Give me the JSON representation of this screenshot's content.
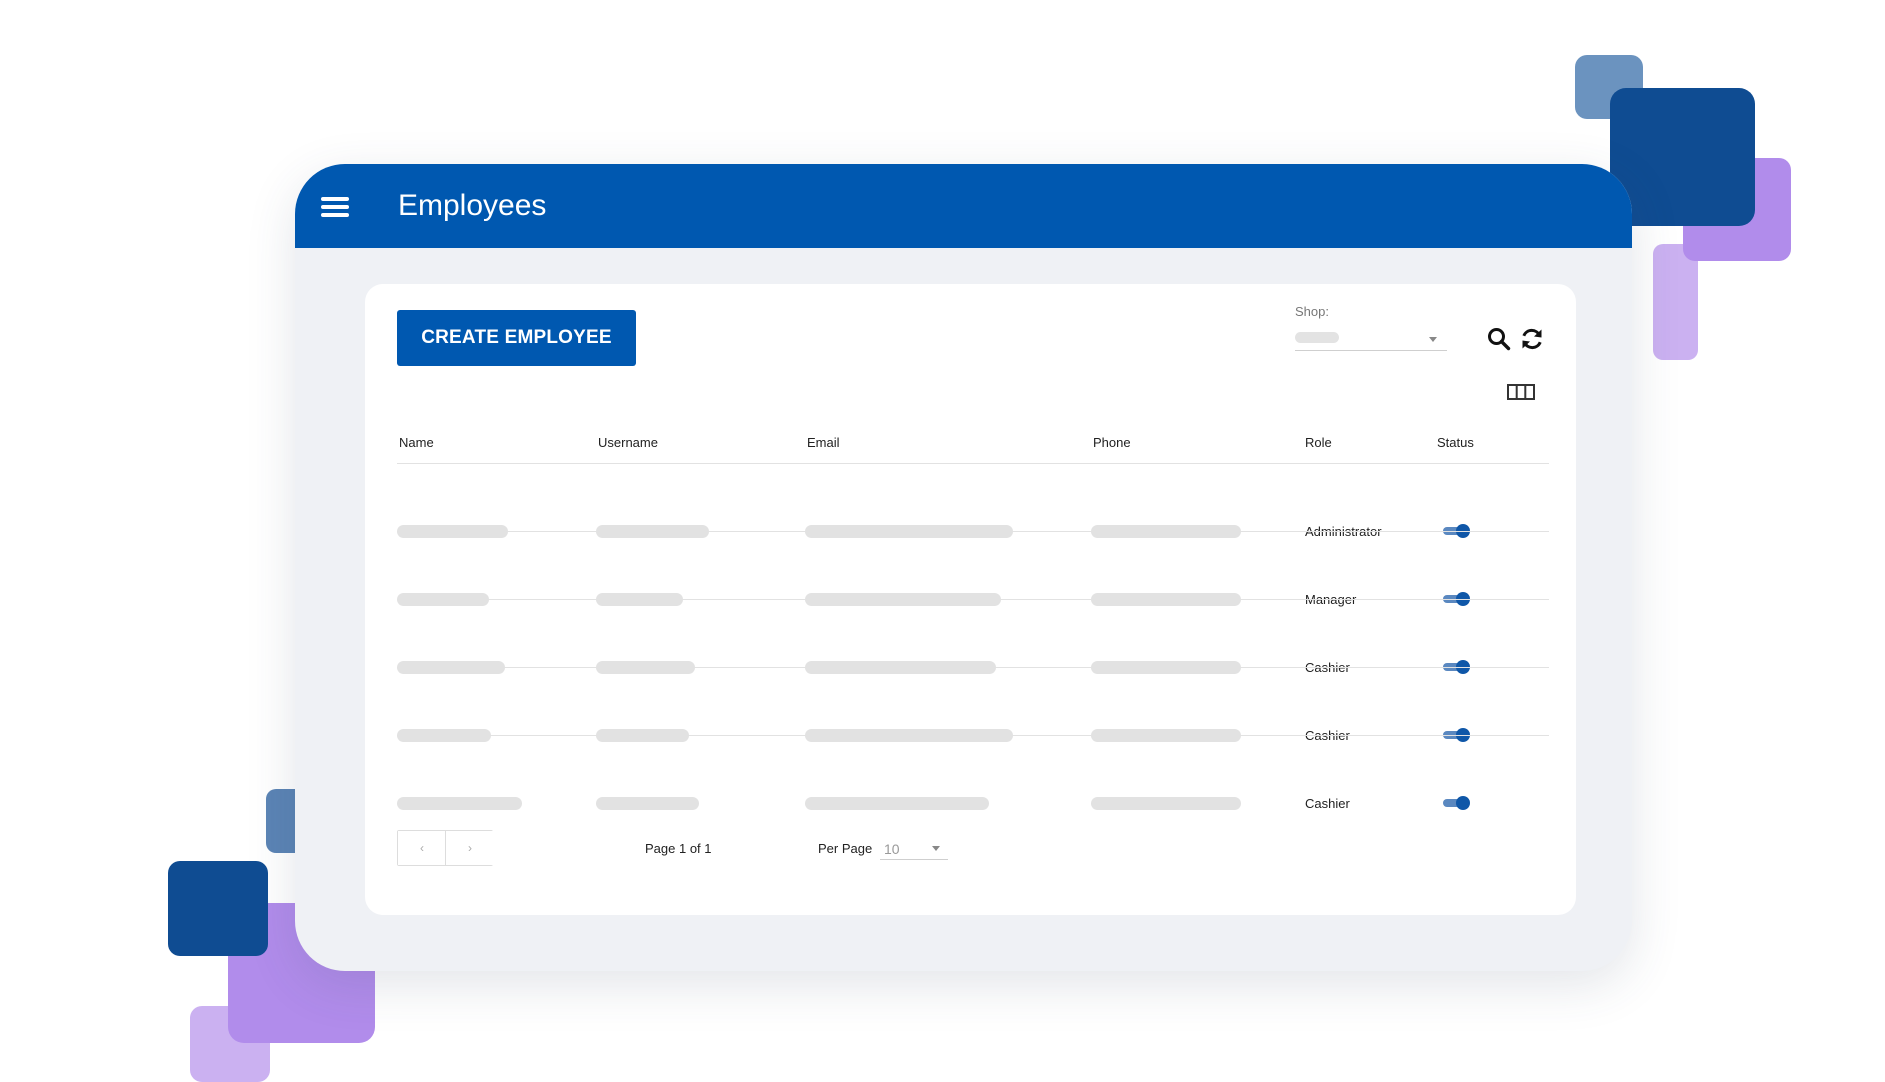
{
  "header": {
    "title": "Employees",
    "menu_icon": "hamburger-menu-icon"
  },
  "toolbar": {
    "create_label": "CREATE EMPLOYEE",
    "shop_label": "Shop:",
    "search_icon": "search-icon",
    "refresh_icon": "refresh-icon",
    "columns_icon": "columns-icon"
  },
  "table": {
    "columns": [
      "Name",
      "Username",
      "Email",
      "Phone",
      "Role",
      "Status"
    ],
    "rows": [
      {
        "role": "Administrator",
        "status_on": true
      },
      {
        "role": "Manager",
        "status_on": true
      },
      {
        "role": "Cashier",
        "status_on": true
      },
      {
        "role": "Cashier",
        "status_on": true
      },
      {
        "role": "Cashier",
        "status_on": true
      }
    ]
  },
  "pagination": {
    "prev_label": "‹",
    "next_label": "›",
    "page_info": "Page 1 of 1",
    "per_page_label": "Per Page",
    "per_page_value": "10"
  },
  "colors": {
    "primary": "#0058b0",
    "toggle_on": "#0f57a8",
    "deco_dark_blue": "#0f4c92",
    "deco_light_blue": "#6b93bf",
    "deco_purple": "#b18ceb",
    "deco_light_purple": "#cbb1f1"
  }
}
